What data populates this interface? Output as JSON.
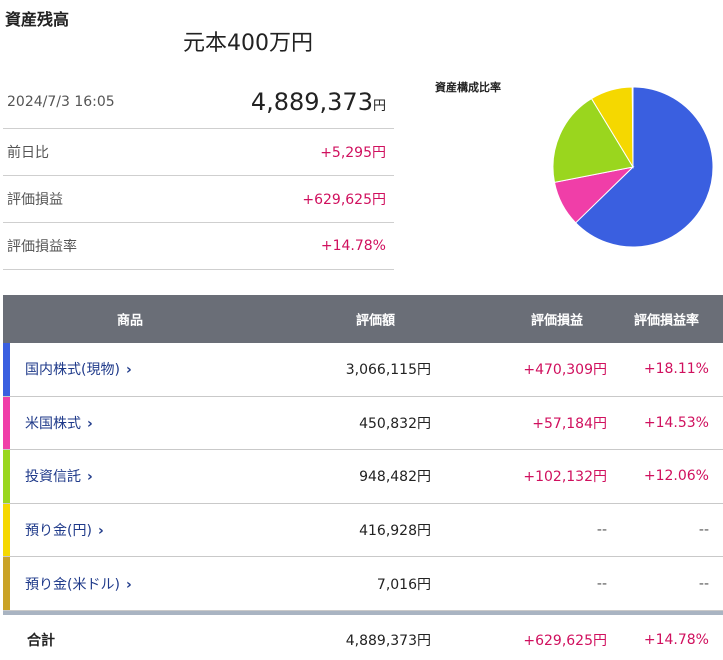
{
  "header": {
    "title": "資産残高",
    "subtitle": "元本400万円"
  },
  "summary": {
    "datetime": "2024/7/3 16:05",
    "total": "4,889,373",
    "yen": "円",
    "rows": [
      {
        "label": "前日比",
        "value": "+5,295円"
      },
      {
        "label": "評価損益",
        "value": "+629,625円"
      },
      {
        "label": "評価損益率",
        "value": "+14.78%"
      }
    ]
  },
  "pie": {
    "title": "資産構成比率",
    "segments": [
      {
        "name": "国内株式(現物)",
        "value": 3066115,
        "color": "#3a5fe0"
      },
      {
        "name": "米国株式",
        "value": 450832,
        "color": "#f03ea8"
      },
      {
        "name": "投資信託",
        "value": 948482,
        "color": "#9ad61e"
      },
      {
        "name": "預り金(円)",
        "value": 416928,
        "color": "#f5d800"
      },
      {
        "name": "預り金(米ドル)",
        "value": 7016,
        "color": "#c9a227"
      }
    ]
  },
  "table": {
    "headers": [
      "商品",
      "評価額",
      "評価損益",
      "評価損益率"
    ],
    "rows": [
      {
        "name": "国内株式(現物)",
        "amount": "3,066,115円",
        "gain": "+470,309円",
        "rate": "+18.11%",
        "color": "#3a5fe0"
      },
      {
        "name": "米国株式",
        "amount": "450,832円",
        "gain": "+57,184円",
        "rate": "+14.53%",
        "color": "#f03ea8"
      },
      {
        "name": "投資信託",
        "amount": "948,482円",
        "gain": "+102,132円",
        "rate": "+12.06%",
        "color": "#9ad61e"
      },
      {
        "name": "預り金(円)",
        "amount": "416,928円",
        "gain": "--",
        "rate": "--",
        "color": "#f5d800"
      },
      {
        "name": "預り金(米ドル)",
        "amount": "7,016円",
        "gain": "--",
        "rate": "--",
        "color": "#c9a227"
      }
    ],
    "chevron": "›",
    "total": {
      "name": "合計",
      "amount": "4,889,373円",
      "gain": "+629,625円",
      "rate": "+14.78%"
    }
  }
}
